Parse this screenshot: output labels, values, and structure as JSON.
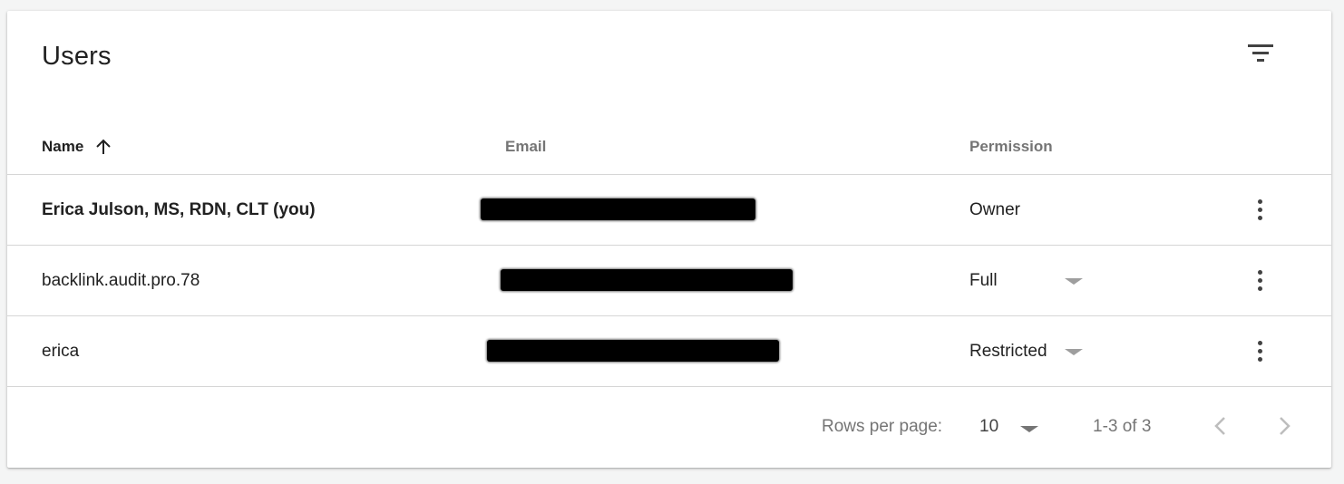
{
  "card": {
    "title": "Users"
  },
  "icons": {
    "filter": "filter-list-icon",
    "sort": "arrow-up-icon",
    "more": "more-vert-icon",
    "prev": "chevron-left-icon",
    "next": "chevron-right-icon"
  },
  "table": {
    "columns": {
      "name": "Name",
      "email": "Email",
      "permission": "Permission"
    },
    "rows": [
      {
        "name": "Erica Julson, MS, RDN, CLT (you)",
        "email": "",
        "email_redacted": true,
        "permission": "Owner",
        "permission_editable": false,
        "bold": true
      },
      {
        "name": "backlink.audit.pro.78",
        "email": "",
        "email_redacted": true,
        "permission": "Full",
        "permission_editable": true,
        "bold": false
      },
      {
        "name": "erica",
        "email": "",
        "email_redacted": true,
        "permission": "Restricted",
        "permission_editable": true,
        "bold": false
      }
    ]
  },
  "footer": {
    "rows_per_page_label": "Rows per page:",
    "rows_per_page_value": "10",
    "range": "1-3 of 3"
  },
  "colors": {
    "background": "#f4f5f5",
    "card": "#ffffff",
    "divider": "#d6d6d6",
    "muted": "#757575",
    "text": "#212121"
  }
}
